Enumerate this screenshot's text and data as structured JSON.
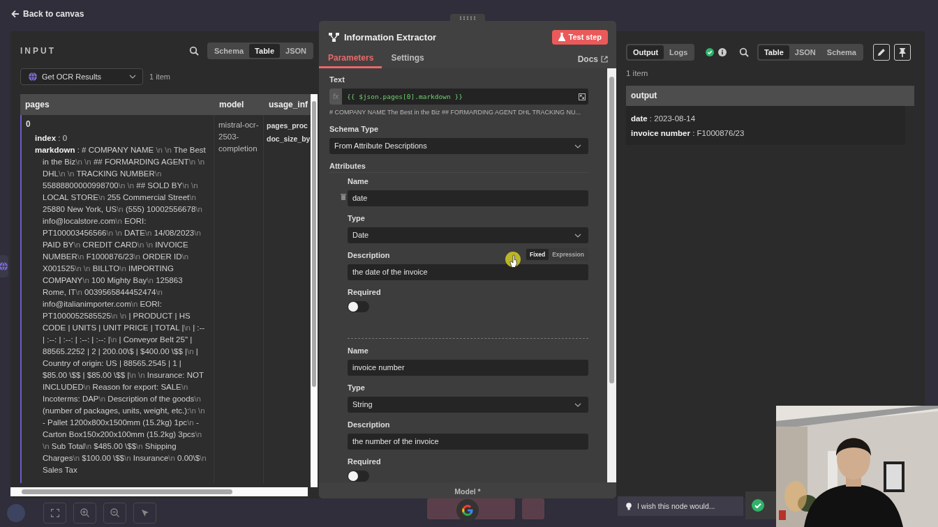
{
  "top_bar": {
    "back_link": "Back to canvas"
  },
  "input_panel": {
    "title": "INPUT",
    "view_tabs": [
      {
        "label": "Schema",
        "selected": false
      },
      {
        "label": "Table",
        "selected": true
      },
      {
        "label": "JSON",
        "selected": false
      }
    ],
    "node_select": "Get OCR Results",
    "item_count": "1 item",
    "table": {
      "columns": [
        "pages",
        "model",
        "usage_inf"
      ],
      "row": {
        "pages": {
          "index": "0",
          "fields": [
            "**index** : 0",
            "**markdown** : # COMPANY NAME \\n \\n The Best in the Biz\\n \\n ## FORMARDING AGENT\\n \\n DHL\\n \\n TRACKING NUMBER\\n 55888800000998700\\n \\n ## SOLD BY\\n \\n LOCAL STORE\\n 255 Commercial Street\\n 25880 New York, US\\n (555) 10002556678\\n info@localstore.com\\n EORI: PT100003456566\\n \\n DATE\\n 14/08/2023\\n PAID BY\\n CREDIT CARD\\n \\n INVOICE NUMBER\\n F1000876/23\\n ORDER ID\\n X001525\\n \\n BILLTO\\n IMPORTING COMPANY\\n 100 Mighty Bay\\n 125863 Rome, IT\\n 0039565844452474\\n info@italianimporter.com\\n EORI: PT1000052585525\\n \\n | PRODUCT | HS CODE | UNITS | UNIT PRICE | TOTAL |\\n | :-- | :--: | :--: | :--: | :--: |\\n | Conveyor Belt 25\" | 88565.2252 | 2 | 200.00\\$ | $400.00 \\$$ |\\n | Country of origin: US | 88565.2545 | 1 | $85.00 \\$$ | $85.00 \\$$ |\\n \\n Insurance: NOT INCLUDED\\n Reason for export: SALE\\n Incoterms: DAP\\n Description of the goods\\n (number of packages, units, weight, etc.):\\n \\n - Pallet 1200x800x1500mm (15.2kg) 1pc\\n - Carton Box150x200x100mm (15.2kg) 3pcs\\n \\n Sub Total\\n $485.00 \\$$\\n Shipping Charges\\n $100.00 \\$$\\n Insurance\\n 0.00\\$\\n Sales Tax"
          ]
        },
        "model": "mistral-ocr-2503-completion",
        "usage_info": [
          "pages_proc",
          "doc_size_by"
        ]
      }
    }
  },
  "node_dialog": {
    "title": "Information Extractor",
    "test_button": "Test step",
    "tabs": [
      {
        "label": "Parameters",
        "selected": true
      },
      {
        "label": "Settings",
        "selected": false
      }
    ],
    "docs_link": "Docs",
    "text_param": {
      "label": "Text",
      "badge": "fx",
      "expression": "{{ $json.pages[0].markdown }}",
      "preview": "# COMPANY NAME  The Best in the Biz ## FORMARDING AGENT DHL TRACKING NU..."
    },
    "schema_type": {
      "label": "Schema Type",
      "value": "From Attribute Descriptions"
    },
    "attributes_label": "Attributes",
    "attributes": [
      {
        "hovered": true,
        "name_label": "Name",
        "name": "date",
        "type_label": "Type",
        "type": "Date",
        "description_label": "Description",
        "mode_options": [
          {
            "label": "Fixed",
            "selected": true
          },
          {
            "label": "Expression",
            "selected": false
          }
        ],
        "description": "the date of the invoice",
        "required_label": "Required",
        "required": false
      },
      {
        "hovered": false,
        "name_label": "Name",
        "name": "invoice number",
        "type_label": "Type",
        "type": "String",
        "description_label": "Description",
        "description": "the number of the invoice",
        "required_label": "Required",
        "required": false
      }
    ],
    "model_label": "Model *"
  },
  "output_panel": {
    "mode_tabs": [
      {
        "label": "Output",
        "selected": true
      },
      {
        "label": "Logs",
        "selected": false
      }
    ],
    "view_tabs": [
      {
        "label": "Table",
        "selected": true
      },
      {
        "label": "JSON",
        "selected": false
      },
      {
        "label": "Schema",
        "selected": false
      }
    ],
    "item_count": "1 item",
    "table": {
      "column": "output",
      "fields": [
        "**date** : 2023-08-14",
        "**invoice number** : F1000876/23"
      ]
    }
  },
  "feedback": {
    "placeholder": "I wish this node would..."
  }
}
